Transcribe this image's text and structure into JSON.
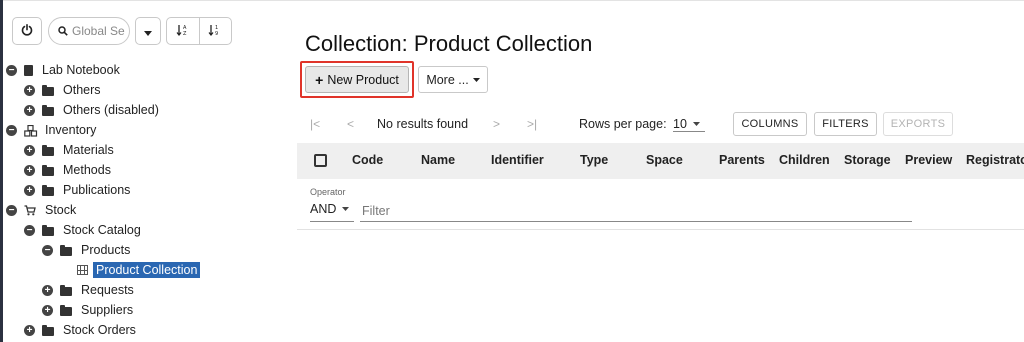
{
  "toolbar": {
    "power_icon": "power-icon",
    "search_placeholder": "Global Se",
    "dropdown_icon": "caret-down-icon",
    "sort_az_icon": "sort-alpha-icon",
    "sort_num_icon": "sort-numeric-icon"
  },
  "tree": {
    "lab_notebook": "Lab Notebook",
    "others": "Others",
    "others_disabled": "Others (disabled)",
    "inventory": "Inventory",
    "materials": "Materials",
    "methods": "Methods",
    "publications": "Publications",
    "stock": "Stock",
    "stock_catalog": "Stock Catalog",
    "products": "Products",
    "product_collection": "Product Collection",
    "requests": "Requests",
    "suppliers": "Suppliers",
    "stock_orders": "Stock Orders"
  },
  "main": {
    "title": "Collection: Product Collection",
    "new_product": "New Product",
    "more": "More ...",
    "first_page": "|<",
    "prev_page": "<",
    "no_results": "No results found",
    "next_page": ">",
    "last_page": ">|",
    "rows_per_page_label": "Rows per page:",
    "rows_per_page_value": "10",
    "columns_btn": "COLUMNS",
    "filters_btn": "FILTERS",
    "exports_btn": "EXPORTS",
    "columns": [
      "Code",
      "Name",
      "Identifier",
      "Type",
      "Space",
      "Parents",
      "Children",
      "Storage",
      "Preview",
      "Registrator"
    ],
    "operator_label": "Operator",
    "operator_value": "AND",
    "filter_placeholder": "Filter"
  },
  "colors": {
    "accent": "#2a67b2",
    "highlight": "#e0342a"
  }
}
